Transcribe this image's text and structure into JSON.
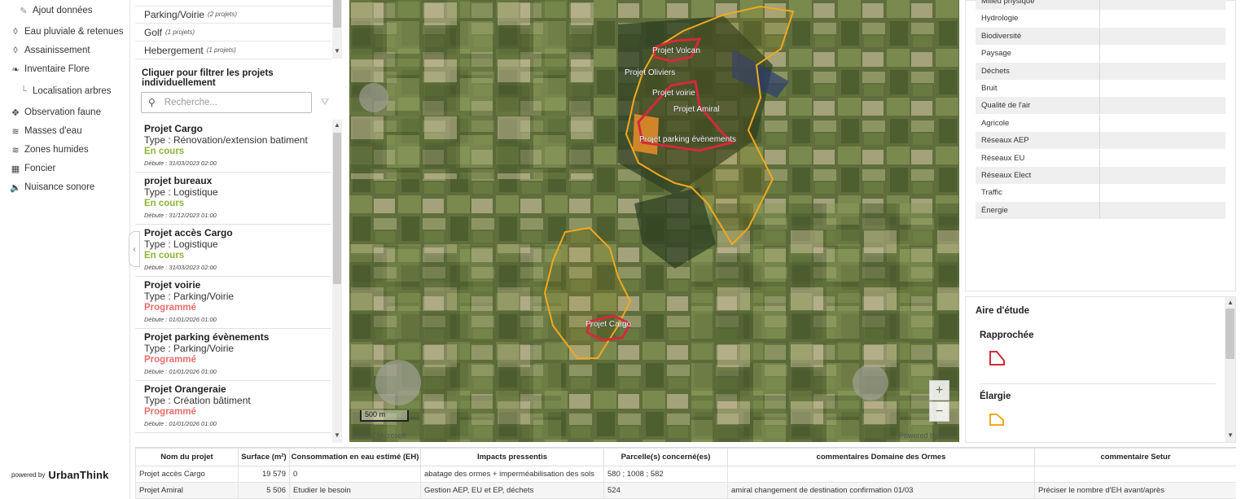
{
  "nav": {
    "items": [
      {
        "label": "Ajout données",
        "icon": "edit-icon",
        "sub": true
      },
      {
        "label": "Eau pluviale & retenues",
        "icon": "drop-icon"
      },
      {
        "label": "Assainissement",
        "icon": "drop-icon"
      },
      {
        "label": "Inventaire Flore",
        "icon": "leaf-icon"
      },
      {
        "label": "Localisation arbres",
        "icon": "tree-branch-icon",
        "sub": true
      },
      {
        "label": "Observation faune",
        "icon": "paw-icon"
      },
      {
        "label": "Masses d'eau",
        "icon": "water-waves-icon"
      },
      {
        "label": "Zones humides",
        "icon": "wetland-icon"
      },
      {
        "label": "Foncier",
        "icon": "building-icon"
      },
      {
        "label": "Nuisance sonore",
        "icon": "speaker-icon"
      }
    ],
    "powered_by": "powered by",
    "brand": "UrbanThink"
  },
  "project_types": [
    {
      "label": "Parking/Voirie",
      "count": "(2 projets)"
    },
    {
      "label": "Golf",
      "count": "(1 projets)"
    },
    {
      "label": "Hebergement",
      "count": "(1 projets)"
    }
  ],
  "filter_hint": "Cliquer pour filtrer les projets individuellement",
  "search": {
    "placeholder": "Recherche..."
  },
  "projects": [
    {
      "name": "Projet Cargo",
      "type": "Type : Rénovation/extension batiment",
      "status": "En cours",
      "status_color": "#8db43a",
      "date": "Débute : 31/03/2023 02:00"
    },
    {
      "name": "projet bureaux",
      "type": "Type : Logistique",
      "status": "En cours",
      "status_color": "#8db43a",
      "date": "Débute : 31/12/2023 01:00"
    },
    {
      "name": "Projet accès Cargo",
      "type": "Type : Logistique",
      "status": "En cours",
      "status_color": "#8db43a",
      "date": "Débute : 31/03/2023 02:00"
    },
    {
      "name": "Projet voirie",
      "type": "Type : Parking/Voirie",
      "status": "Programmé",
      "status_color": "#e36f6f",
      "date": "Débute : 01/01/2026 01:00"
    },
    {
      "name": "Projet parking évènements",
      "type": "Type : Parking/Voirie",
      "status": "Programmé",
      "status_color": "#e36f6f",
      "date": "Débute : 01/01/2026 01:00"
    },
    {
      "name": "Projet Orangeraie",
      "type": "Type : Création bâtiment",
      "status": "Programmé",
      "status_color": "#e36f6f",
      "date": "Débute : 01/01/2026 01:00"
    }
  ],
  "map": {
    "labels": [
      "Projet Volcan",
      "Projet Oliviers",
      "Projet voirie",
      "Projet Amiral",
      "Projet parking évènements",
      "Projet Cargo"
    ],
    "scale": "500 m",
    "attribution_left": "Maxar, Microsoft",
    "attribution_right": "Powered by Esri",
    "zoom_in": "+",
    "zoom_out": "−",
    "colors": {
      "rapprochee": "#d42a3a",
      "elargie": "#f0a91e"
    }
  },
  "themes": [
    "Milieu physique",
    "Hydrologie",
    "Biodiversité",
    "Paysage",
    "Déchets",
    "Bruit",
    "Qualité de l'air",
    "Agricole",
    "Réseaux AEP",
    "Réseaux EU",
    "Réseaux Elect",
    "Traffic",
    "Énergie"
  ],
  "aire_etude": {
    "title": "Aire d'étude",
    "rapprochee": "Rapprochée",
    "elargie": "Élargie"
  },
  "table": {
    "headers": [
      "Nom du projet",
      "Surface (m²)",
      "Consommation en eau estimé (EH)",
      "Impacts pressentis",
      "Parcelle(s) concerné(es)",
      "commentaires Domaine des Ormes",
      "commentaire Setur"
    ],
    "rows": [
      [
        "Projet accès Cargo",
        "19 579",
        "0",
        "abatage des ormes + imperméabilisation des sols",
        "580 ; 1008 ; 582",
        "",
        ""
      ],
      [
        "Projet Amiral",
        "5 506",
        "Etudier le besoin",
        "Gestion AEP, EU et EP, déchets",
        "524",
        "amiral changement de destination confirmation 01/03",
        "Préciser le nombre d'EH avant/après"
      ]
    ]
  }
}
